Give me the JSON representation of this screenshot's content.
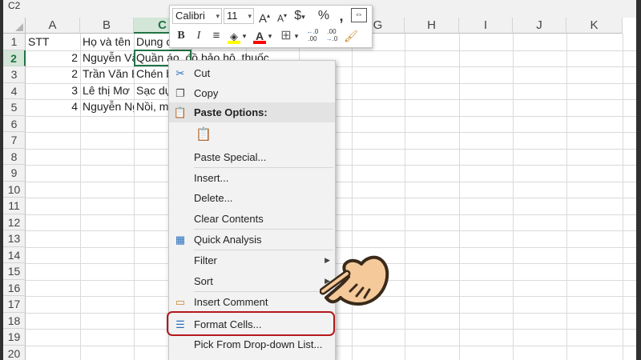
{
  "window": {
    "namebox": "C2"
  },
  "columns": [
    "A",
    "B",
    "C",
    "D",
    "E",
    "F",
    "G",
    "H",
    "I",
    "J",
    "K"
  ],
  "selected_column": "C",
  "rows": [
    "1",
    "2",
    "3",
    "4",
    "5",
    "6",
    "7",
    "8",
    "9",
    "10",
    "11",
    "12",
    "13",
    "14",
    "15",
    "16",
    "17",
    "18",
    "19",
    "20"
  ],
  "selected_row": "2",
  "cells": {
    "A1": "STT",
    "B1": "Họ và tên",
    "C1": "Dụng c",
    "A2": "2",
    "B2": "Nguyễn Vă",
    "C2": "Quần áo, đồ bảo hộ, thuốc",
    "A3": "2",
    "B3": "Trần Văn B",
    "C3": "Chén b",
    "A4": "3",
    "B4": "Lê thị Mơ",
    "C4": "Sạc dụ",
    "A5": "4",
    "B5": "Nguyễn Ng",
    "C5": "Nồi, m"
  },
  "mini_toolbar": {
    "font_name": "Calibri",
    "font_size": "11",
    "increase_font_icon": "font-grow-icon",
    "decrease_font_icon": "font-shrink-icon",
    "currency_symbol": "$",
    "percent_symbol": "%",
    "comma_symbol": ",",
    "bold": "B",
    "italic": "I",
    "font_color_letter": "A",
    "fill_color": "#ffff00",
    "font_color": "#ff0000",
    "increase_decimal": "←.0\n.00",
    "decrease_decimal": ".00\n→.0"
  },
  "context_menu": {
    "items": [
      {
        "label": "Cut",
        "icon": "scissors-icon"
      },
      {
        "label": "Copy",
        "icon": "copy-icon"
      },
      {
        "label": "Paste Options:",
        "icon": "paste-icon",
        "header": true
      },
      {
        "label": "",
        "icon": "paste-option-icon"
      },
      {
        "label": "Paste Special...",
        "icon": ""
      },
      {
        "label": "Insert...",
        "icon": ""
      },
      {
        "label": "Delete...",
        "icon": ""
      },
      {
        "label": "Clear Contents",
        "icon": ""
      },
      {
        "label": "Quick Analysis",
        "icon": "quick-analysis-icon"
      },
      {
        "label": "Filter",
        "icon": "",
        "submenu": true
      },
      {
        "label": "Sort",
        "icon": "",
        "submenu": true
      },
      {
        "label": "Insert Comment",
        "icon": "comment-icon"
      },
      {
        "label": "Format Cells...",
        "icon": "format-cells-icon",
        "highlighted": true
      },
      {
        "label": "Pick From Drop-down List...",
        "icon": ""
      }
    ]
  },
  "colors": {
    "excel_green": "#217346",
    "highlight_red": "#b5181b",
    "hand_fill": "#f5c99a"
  }
}
